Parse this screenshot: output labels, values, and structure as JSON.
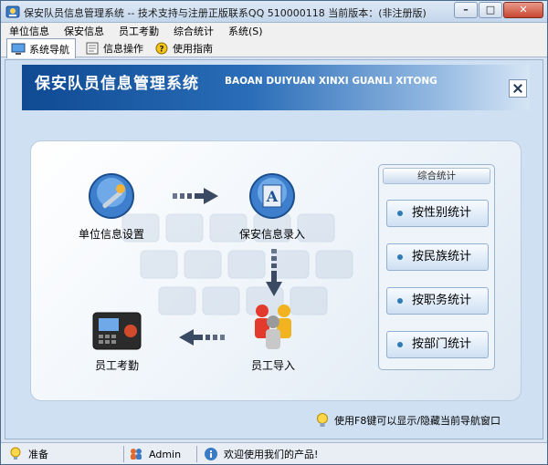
{
  "window": {
    "title": "保安队员信息管理系统 -- 技术支持与注册正版联系QQ 510000118   当前版本：(非注册版)"
  },
  "menu": [
    "单位信息",
    "保安信息",
    "员工考勤",
    "综合统计",
    "系统(S)"
  ],
  "toolbar": {
    "tabs": [
      {
        "label": "系统导航",
        "icon": "monitor-icon"
      },
      {
        "label": "信息操作",
        "icon": "document-icon"
      },
      {
        "label": "使用指南",
        "icon": "help-icon"
      }
    ]
  },
  "banner": {
    "title": "保安队员信息管理系统",
    "subtitle": "BAOAN DUIYUAN XINXI GUANLI XITONG"
  },
  "nav": {
    "unit_info": "单位信息设置",
    "guard_entry": "保安信息录入",
    "staff_import": "员工导入",
    "attendance": "员工考勤"
  },
  "stats": {
    "header": "综合统计",
    "buttons": [
      "按性别统计",
      "按民族统计",
      "按职务统计",
      "按部门统计"
    ]
  },
  "hint": "使用F8键可以显示/隐藏当前导航窗口",
  "statusbar": {
    "status": "准备",
    "user": "Admin",
    "welcome": "欢迎使用我们的产品!"
  },
  "colors": {
    "banner_start": "#0f4a93",
    "accent": "#2e7ab5",
    "arrow": "#3b4a63"
  }
}
